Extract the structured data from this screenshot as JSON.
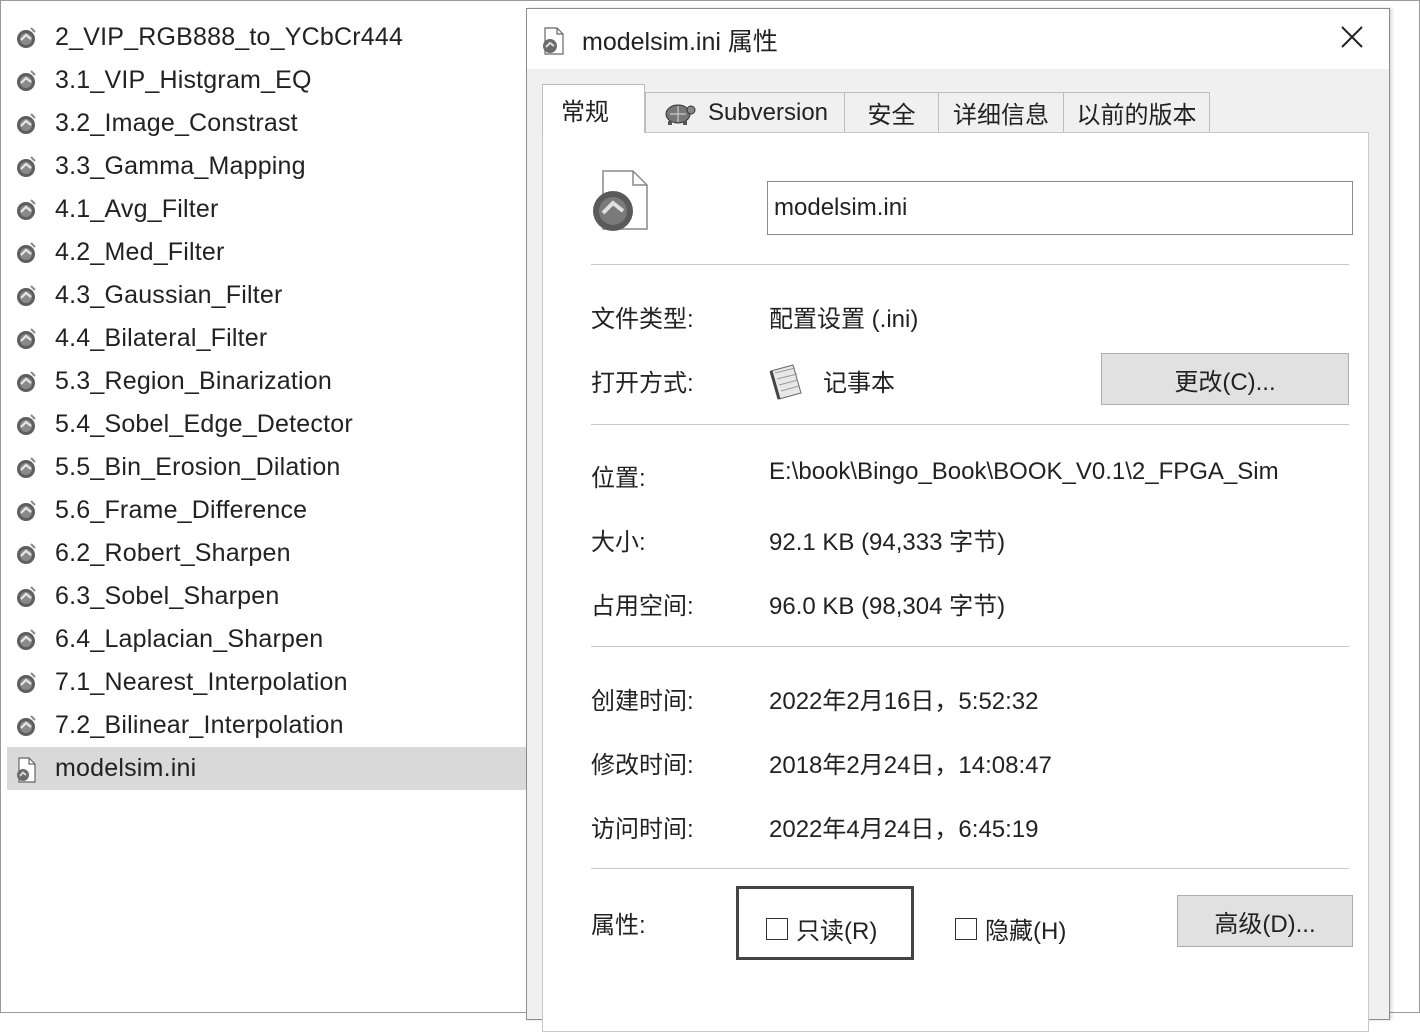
{
  "file_list": [
    {
      "name": "2_VIP_RGB888_to_YCbCr444",
      "type": "folder"
    },
    {
      "name": "3.1_VIP_Histgram_EQ",
      "type": "folder"
    },
    {
      "name": "3.2_Image_Constrast",
      "type": "folder"
    },
    {
      "name": "3.3_Gamma_Mapping",
      "type": "folder"
    },
    {
      "name": "4.1_Avg_Filter",
      "type": "folder"
    },
    {
      "name": "4.2_Med_Filter",
      "type": "folder"
    },
    {
      "name": "4.3_Gaussian_Filter",
      "type": "folder"
    },
    {
      "name": "4.4_Bilateral_Filter",
      "type": "folder"
    },
    {
      "name": "5.3_Region_Binarization",
      "type": "folder"
    },
    {
      "name": "5.4_Sobel_Edge_Detector",
      "type": "folder"
    },
    {
      "name": "5.5_Bin_Erosion_Dilation",
      "type": "folder"
    },
    {
      "name": "5.6_Frame_Difference",
      "type": "folder"
    },
    {
      "name": "6.2_Robert_Sharpen",
      "type": "folder"
    },
    {
      "name": "6.3_Sobel_Sharpen",
      "type": "folder"
    },
    {
      "name": "6.4_Laplacian_Sharpen",
      "type": "folder"
    },
    {
      "name": "7.1_Nearest_Interpolation",
      "type": "folder"
    },
    {
      "name": "7.2_Bilinear_Interpolation",
      "type": "folder"
    },
    {
      "name": "modelsim.ini",
      "type": "file",
      "selected": true
    }
  ],
  "dialog": {
    "title": "modelsim.ini 属性",
    "close_glyph": "✕",
    "tabs": [
      "常规",
      "Subversion",
      "安全",
      "详细信息",
      "以前的版本"
    ],
    "filename": "modelsim.ini",
    "file_type_label": "文件类型:",
    "file_type_value": "配置设置 (.ini)",
    "open_with_label": "打开方式:",
    "open_with_value": "记事本",
    "change_button": "更改(C)...",
    "location_label": "位置:",
    "location_value": "E:\\book\\Bingo_Book\\BOOK_V0.1\\2_FPGA_Sim",
    "size_label": "大小:",
    "size_value": "92.1 KB (94,333 字节)",
    "disk_size_label": "占用空间:",
    "disk_size_value": "96.0 KB (98,304 字节)",
    "created_label": "创建时间:",
    "created_value": "2022年2月16日，5:52:32",
    "modified_label": "修改时间:",
    "modified_value": "2018年2月24日，14:08:47",
    "accessed_label": "访问时间:",
    "accessed_value": "2022年4月24日，6:45:19",
    "attributes_label": "属性:",
    "readonly_label": "只读(R)",
    "hidden_label": "隐藏(H)",
    "advanced_button": "高级(D)..."
  }
}
